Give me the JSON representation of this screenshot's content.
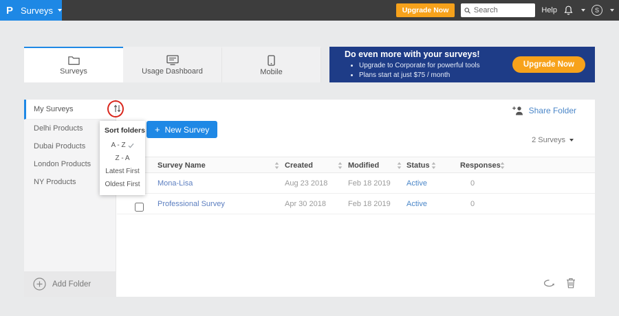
{
  "topbar": {
    "logo": "P",
    "product_menu_label": "Surveys",
    "upgrade_label": "Upgrade Now",
    "search_placeholder": "Search",
    "help_label": "Help",
    "avatar_initial": "S"
  },
  "tabs": [
    {
      "label": "Surveys"
    },
    {
      "label": "Usage Dashboard"
    },
    {
      "label": "Mobile"
    }
  ],
  "banner": {
    "title": "Do even more with your surveys!",
    "bullets": [
      "Upgrade to Corporate for powerful tools",
      "Plans start at just $75 / month"
    ],
    "cta_label": "Upgrade Now"
  },
  "sidebar": {
    "folders": [
      {
        "label": "My Surveys",
        "active": true
      },
      {
        "label": "Delhi Products",
        "active": false
      },
      {
        "label": "Dubai Products",
        "active": false
      },
      {
        "label": "London Products",
        "active": false
      },
      {
        "label": "NY Products",
        "active": false
      }
    ],
    "add_folder_label": "Add Folder"
  },
  "sort_menu": {
    "title": "Sort folders",
    "options": [
      {
        "label": "A - Z",
        "selected": true
      },
      {
        "label": "Z - A",
        "selected": false
      },
      {
        "label": "Latest First",
        "selected": false
      },
      {
        "label": "Oldest First",
        "selected": false
      }
    ]
  },
  "toolbar": {
    "share_folder_label": "Share Folder",
    "new_survey_plus": "+",
    "new_survey_label": "New Survey",
    "survey_count_label": "2 Surveys"
  },
  "table": {
    "headers": [
      "Survey Name",
      "Created",
      "Modified",
      "Status",
      "Responses"
    ],
    "rows": [
      {
        "name": "Mona-Lisa",
        "created": "Aug 23 2018",
        "modified": "Feb 18 2019",
        "status": "Active",
        "responses": "0"
      },
      {
        "name": "Professional Survey",
        "created": "Apr 30 2018",
        "modified": "Feb 18 2019",
        "status": "Active",
        "responses": "0"
      }
    ]
  },
  "colors": {
    "accent_blue": "#1e88e5",
    "banner_navy": "#1e3c87",
    "orange": "#f7a21b",
    "link_blue": "#4a86c8",
    "annotation_red": "#d9261c",
    "topbar_gray": "#3d3d3d"
  }
}
